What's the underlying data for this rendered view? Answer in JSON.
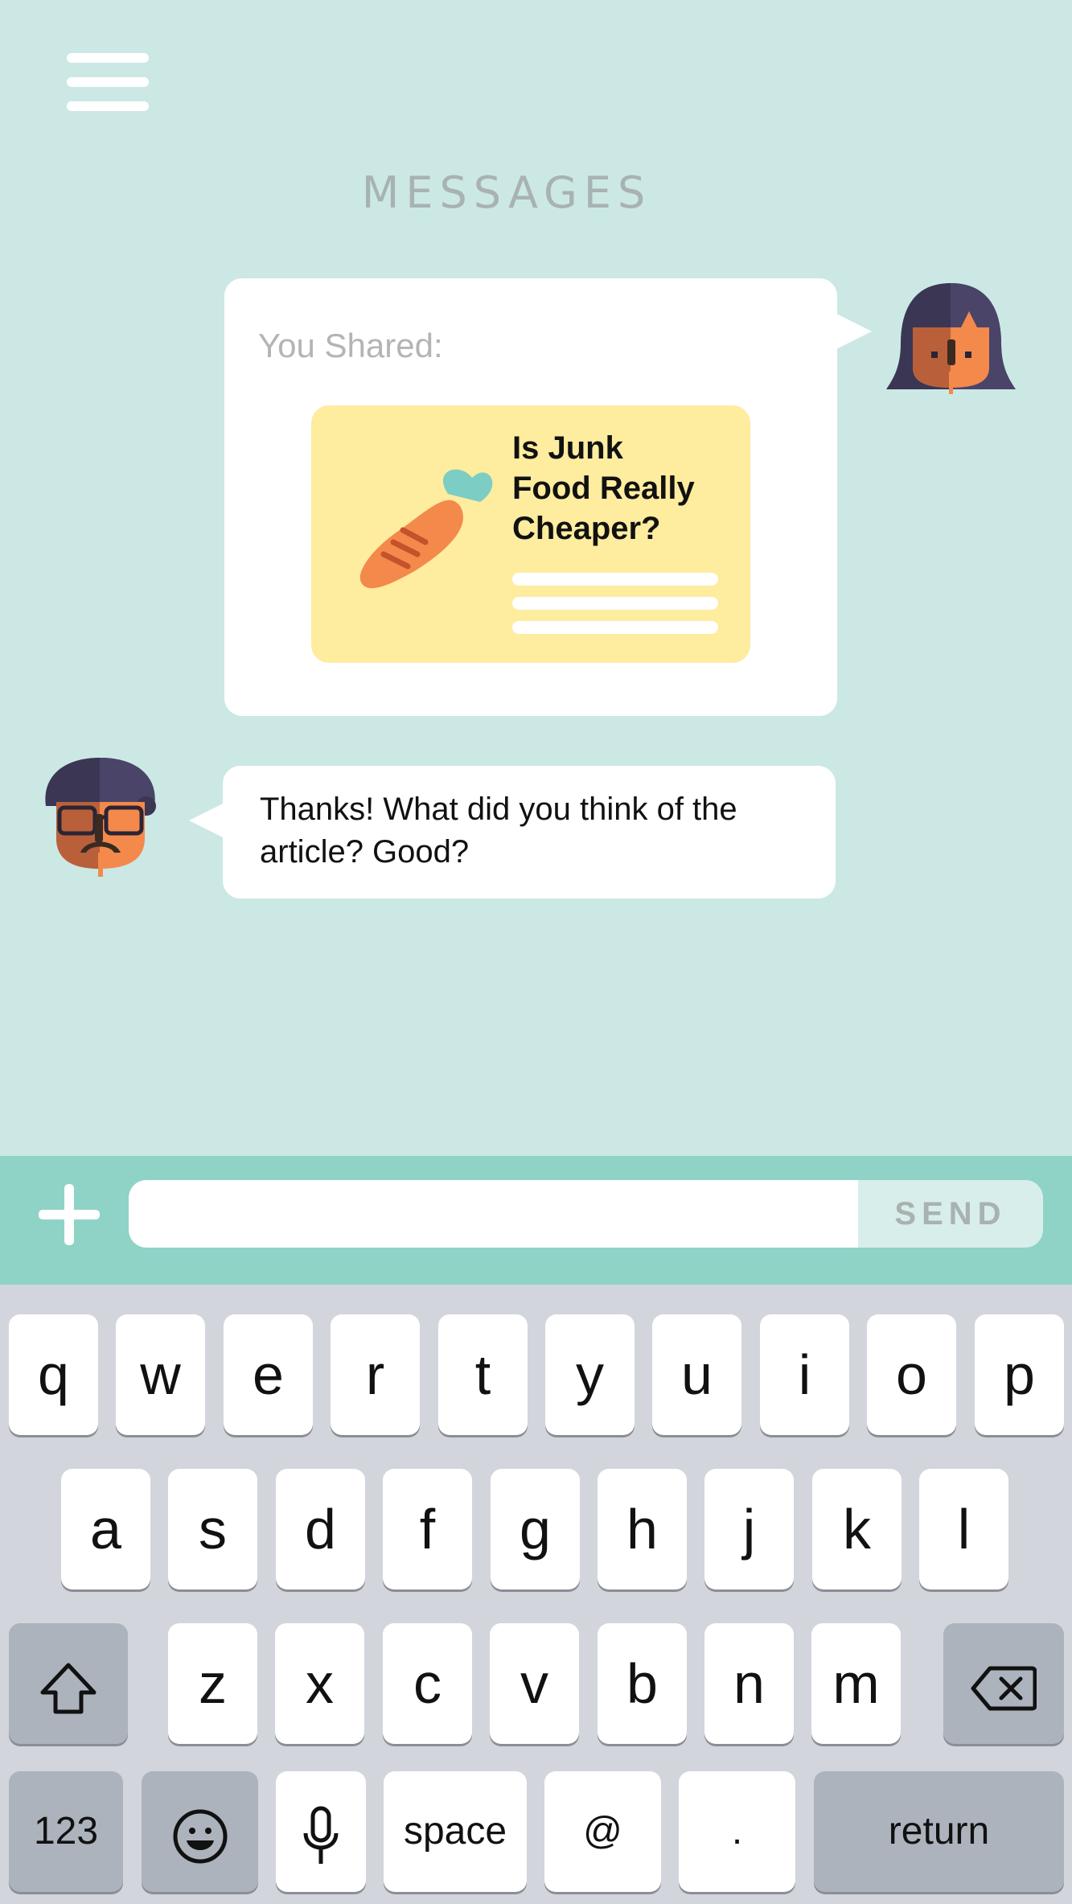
{
  "header": {
    "menu_icon": "hamburger-menu-icon",
    "title": "MESSAGES"
  },
  "conversation": {
    "shared_message": {
      "label": "You Shared:",
      "article": {
        "title": "Is Junk\nFood Really\nCheaper?",
        "image_icon": "carrot-icon"
      },
      "sender_avatar": "woman-avatar"
    },
    "reply_message": {
      "text": "Thanks! What did you think of the article? Good?",
      "sender_avatar": "man-with-glasses-avatar"
    }
  },
  "composer": {
    "plus_icon": "plus-icon",
    "input_value": "",
    "input_placeholder": "",
    "send_label": "SEND"
  },
  "keyboard": {
    "row1": [
      "q",
      "w",
      "e",
      "r",
      "t",
      "y",
      "u",
      "i",
      "o",
      "p"
    ],
    "row2": [
      "a",
      "s",
      "d",
      "f",
      "g",
      "h",
      "j",
      "k",
      "l"
    ],
    "row3": [
      "z",
      "x",
      "c",
      "v",
      "b",
      "n",
      "m"
    ],
    "shift_icon": "shift-arrow-icon",
    "delete_icon": "backspace-icon",
    "numbers_label": "123",
    "emoji_icon": "emoji-icon",
    "mic_icon": "microphone-icon",
    "space_label": "space",
    "at_label": "@",
    "period_label": ".",
    "return_label": "return"
  },
  "colors": {
    "background": "#cbe8e5",
    "composer_bar": "#8ed3c6",
    "article_card": "#feec9f",
    "keyboard_bg": "#d2d5db",
    "function_key": "#acb3bd"
  }
}
